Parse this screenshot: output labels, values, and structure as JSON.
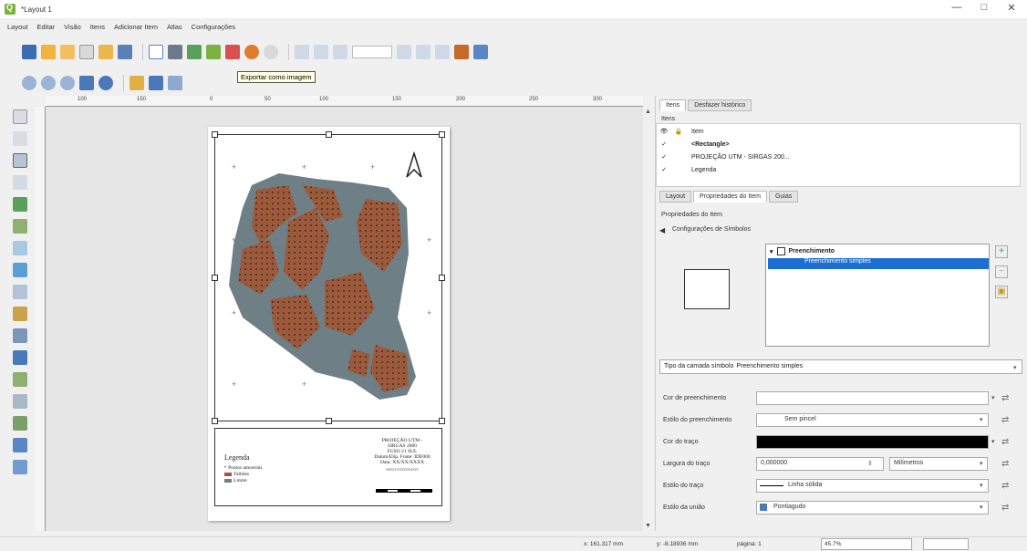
{
  "window": {
    "title": "*Layout 1",
    "minimize": "—",
    "maximize": "□",
    "close": "✕"
  },
  "menubar": [
    "Layout",
    "Editar",
    "Visão",
    "Itens",
    "Adicionar Item",
    "Atlas",
    "Configurações"
  ],
  "tooltip": "Exportar como imagem",
  "ruler": {
    "labels": [
      "100",
      "150",
      "0",
      "50",
      "100",
      "150",
      "200",
      "250",
      "300"
    ]
  },
  "layout_page": {
    "legend_title": "Legenda",
    "legend_items": [
      "Pontos amostrais",
      "Talhões",
      "Limite"
    ],
    "projection_lines": [
      "PROJEÇÃO UTM -",
      "SIRGAS 2000",
      "FUSO 21 SUL",
      "Datum/Elip. Fonte: IDE000",
      "Data: XX/XX/XXXX"
    ],
    "scale_labels": "0.0  0.1  0.2  0.3  0.4  0.5"
  },
  "right_panel": {
    "top_tabs": [
      "Itens",
      "Desfazer histórico"
    ],
    "items_header": "Itens",
    "items_columns": [
      "Item"
    ],
    "items": [
      {
        "label": "<Rectangle>",
        "checked": "✓"
      },
      {
        "label": "PROJEÇÃO UTM - SIRGAS 200...",
        "checked": "✓"
      },
      {
        "label": "Legenda",
        "checked": "✓"
      }
    ],
    "sub_tabs": [
      "Layout",
      "Propriedades do Item",
      "Guias"
    ],
    "properties_title": "Propriedades do Item",
    "symbol_settings": "Configurações de Símbolos",
    "tree": {
      "parent": "Preenchimento",
      "child": "Preenchimento simples"
    },
    "layer_type_label": "Tipo da camada símbolo",
    "layer_type_value": "Preenchimento simples",
    "fields": [
      {
        "label": "Cor de preenchimento",
        "value": ""
      },
      {
        "label": "Estilo do preenchimento",
        "value": "Sem pincel"
      },
      {
        "label": "Cor do traço",
        "value": ""
      },
      {
        "label": "Largura do traço",
        "value": "0,000000",
        "unit": "Milímetros"
      },
      {
        "label": "Estilo do traço",
        "value": "Linha sólida"
      },
      {
        "label": "Estilo da união",
        "value": "Pontiagudo"
      }
    ]
  },
  "statusbar": {
    "x": "x: 161.317 mm",
    "y": "y: -8.18936 mm",
    "page": "página: 1",
    "zoom": "45.7%"
  },
  "colors": {
    "map_gray": "#6f7f86",
    "plot_brown": "#9c5a3c",
    "selection_blue": "#1c6fd1"
  }
}
